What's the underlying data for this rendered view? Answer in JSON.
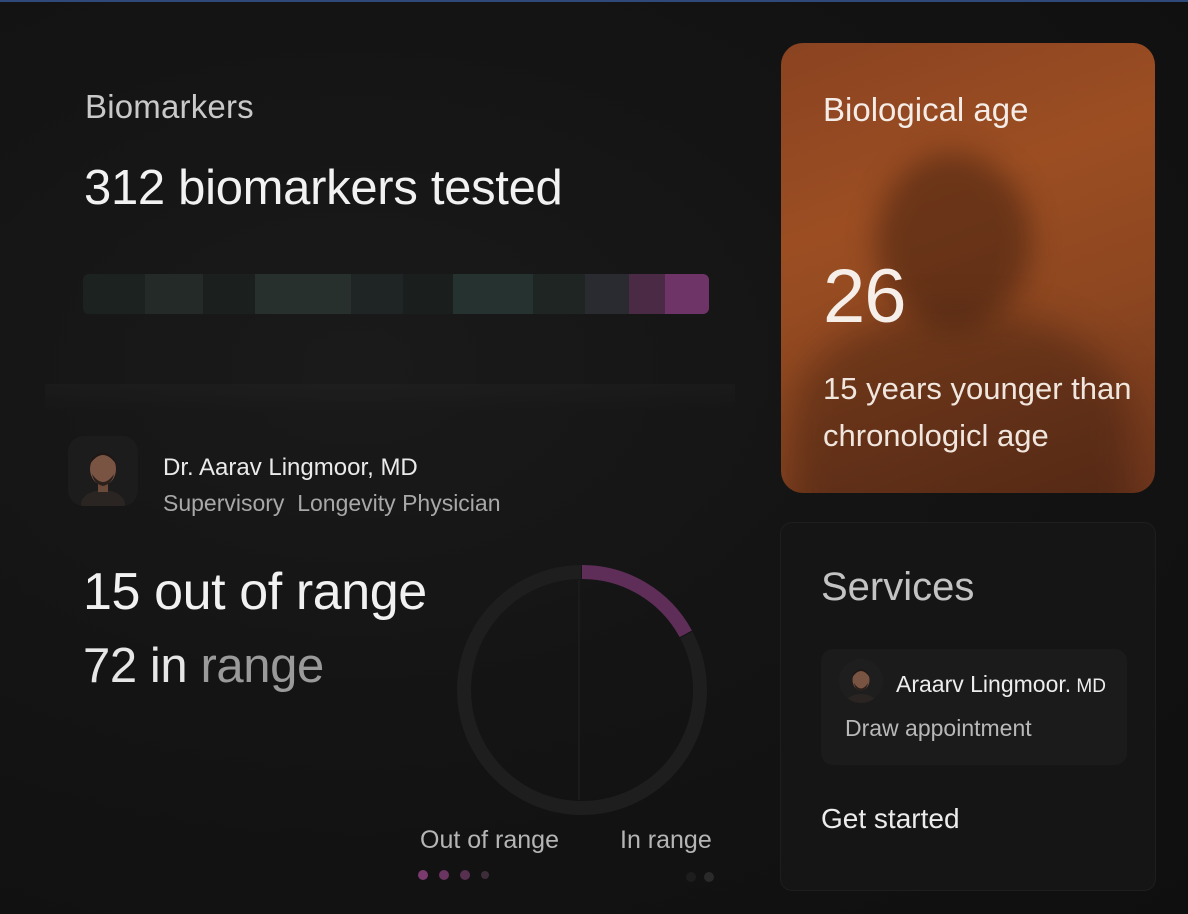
{
  "biomarkers": {
    "section_title": "Biomarkers",
    "headline": "312 biomarkers tested",
    "bar_colors": [
      "#1c2220",
      "#232a27",
      "#1b1f1e",
      "#28302e",
      "#1f2524",
      "#1a1e1d",
      "#263230",
      "#1f2523",
      "#2a2b30",
      "#4a2a45",
      "#6e3468"
    ]
  },
  "physician": {
    "name": "Dr. Aarav Lingmoor, MD",
    "role": "Supervisory  Longevity Physician"
  },
  "stats": {
    "out_of_range": "15 out of range",
    "in_range_count": "72 in",
    "in_range_word": " range"
  },
  "chart_data": {
    "type": "pie",
    "categories": [
      "Out of range",
      "In range"
    ],
    "values": [
      15,
      72
    ],
    "colors": [
      "#5e2e59",
      "#1e1e1e"
    ]
  },
  "legend": {
    "out_label": "Out of range",
    "in_label": "In range",
    "dot_colors": [
      "#7a3a6e",
      "#6a3560",
      "#58304f",
      "#3d2d38"
    ],
    "right_dot_colors": [
      "#1d1d1d",
      "#2a2a2a"
    ]
  },
  "bio_age": {
    "title": "Biological age",
    "value": "26",
    "note": "15 years younger than chronologicl age"
  },
  "services": {
    "title": "Services",
    "appointment_name": "Araarv Lingmoor.",
    "appointment_suffix": " MD",
    "appointment_sub": "Draw appointment",
    "cta": "Get started"
  },
  "colors": {
    "accent_purple": "#6e3468",
    "card_orange": "#9c4e22"
  }
}
